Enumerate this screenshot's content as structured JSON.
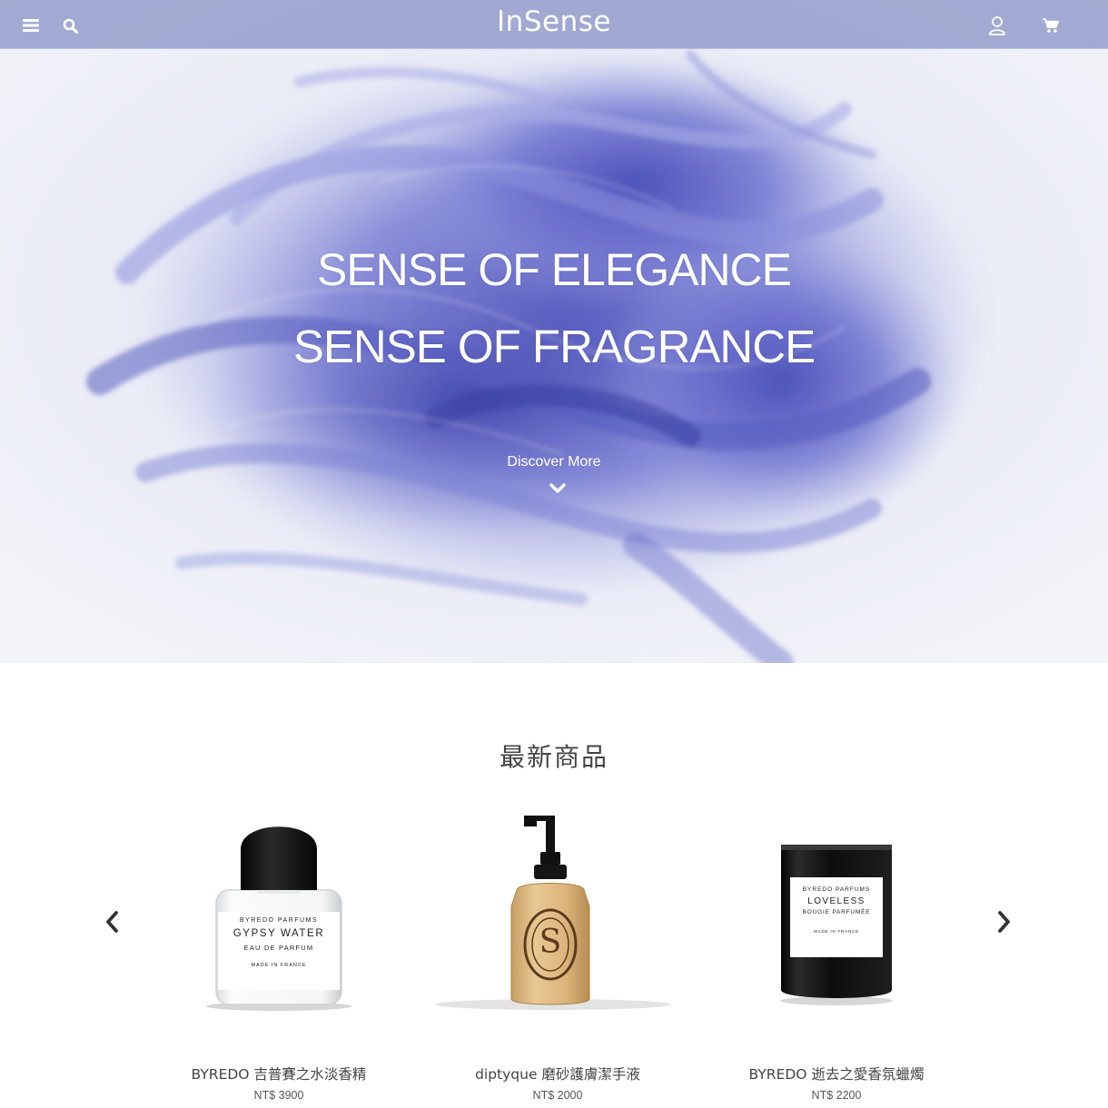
{
  "header": {
    "brand": "InSense",
    "menu_icon": "hamburger-menu-icon",
    "search_icon": "search-icon",
    "account_icon": "user-account-icon",
    "cart_icon": "shopping-cart-icon",
    "bar_color": "#8c96c8"
  },
  "hero": {
    "line1": "SENSE OF ELEGANCE",
    "line2": "SENSE OF FRAGRANCE",
    "cta": "Discover More",
    "cta_icon": "chevron-down-icon",
    "accent_color": "#5a60c8"
  },
  "latest": {
    "title": "最新商品",
    "prev_icon": "chevron-left-icon",
    "next_icon": "chevron-right-icon",
    "products": [
      {
        "name": "BYREDO 吉普賽之水淡香精",
        "price": "NT$ 3900",
        "label": {
          "brand": "BYREDO PARFUMS",
          "title": "GYPSY WATER",
          "subtitle": "EAU DE PARFUM",
          "origin": "MADE IN FRANCE"
        }
      },
      {
        "name": "diptyque 磨砂護膚潔手液",
        "price": "NT$ 2000",
        "label": {
          "brand": "",
          "title": "S",
          "subtitle": "",
          "origin": ""
        }
      },
      {
        "name": "BYREDO 逝去之愛香氛蠟燭",
        "price": "NT$ 2200",
        "label": {
          "brand": "BYREDO PARFUMS",
          "title": "LOVELESS",
          "subtitle": "BOUGIE PARFUMÉE",
          "origin": "MADE IN FRANCE"
        }
      }
    ]
  }
}
